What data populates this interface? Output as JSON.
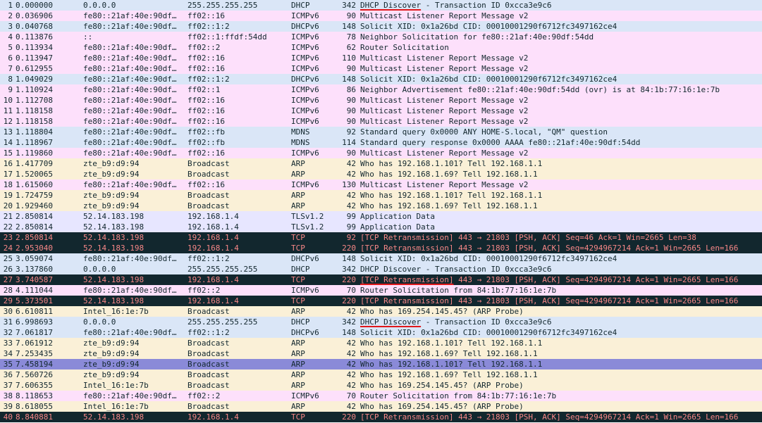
{
  "colors": {
    "dhcp": "#dae6f7",
    "icmpv6": "#fde0fb",
    "arp": "#faf0d7",
    "tls": "#e7e6ff",
    "bad_tcp_bg": "#12272e",
    "bad_tcp_fg": "#f78787",
    "selected": "#8a8ad8",
    "highlight_underline": "#e0181b"
  },
  "packets": [
    {
      "no": "1",
      "time": "0.000000",
      "src": "0.0.0.0",
      "dst": "255.255.255.255",
      "proto": "DHCP",
      "len": "342",
      "info": "DHCP Discover - Transaction ID 0xcca3e9c6",
      "color": "dhcp",
      "hl": "DHCP Discover"
    },
    {
      "no": "2",
      "time": "0.036906",
      "src": "fe80::21af:40e:90df…",
      "dst": "ff02::16",
      "proto": "ICMPv6",
      "len": "90",
      "info": "Multicast Listener Report Message v2",
      "color": "icmp"
    },
    {
      "no": "3",
      "time": "0.040768",
      "src": "fe80::21af:40e:90df…",
      "dst": "ff02::1:2",
      "proto": "DHCPv6",
      "len": "148",
      "info": "Solicit XID: 0x1a26bd CID: 00010001290f6712fc3497162ce4",
      "color": "dhcp"
    },
    {
      "no": "4",
      "time": "0.113876",
      "src": "::",
      "dst": "ff02::1:ffdf:54dd",
      "proto": "ICMPv6",
      "len": "78",
      "info": "Neighbor Solicitation for fe80::21af:40e:90df:54dd",
      "color": "icmp"
    },
    {
      "no": "5",
      "time": "0.113934",
      "src": "fe80::21af:40e:90df…",
      "dst": "ff02::2",
      "proto": "ICMPv6",
      "len": "62",
      "info": "Router Solicitation",
      "color": "icmp"
    },
    {
      "no": "6",
      "time": "0.113947",
      "src": "fe80::21af:40e:90df…",
      "dst": "ff02::16",
      "proto": "ICMPv6",
      "len": "110",
      "info": "Multicast Listener Report Message v2",
      "color": "icmp"
    },
    {
      "no": "7",
      "time": "0.612955",
      "src": "fe80::21af:40e:90df…",
      "dst": "ff02::16",
      "proto": "ICMPv6",
      "len": "90",
      "info": "Multicast Listener Report Message v2",
      "color": "icmp"
    },
    {
      "no": "8",
      "time": "1.049029",
      "src": "fe80::21af:40e:90df…",
      "dst": "ff02::1:2",
      "proto": "DHCPv6",
      "len": "148",
      "info": "Solicit XID: 0x1a26bd CID: 00010001290f6712fc3497162ce4",
      "color": "dhcp"
    },
    {
      "no": "9",
      "time": "1.110924",
      "src": "fe80::21af:40e:90df…",
      "dst": "ff02::1",
      "proto": "ICMPv6",
      "len": "86",
      "info": "Neighbor Advertisement fe80::21af:40e:90df:54dd (ovr) is at 84:1b:77:16:1e:7b",
      "color": "icmp"
    },
    {
      "no": "10",
      "time": "1.112708",
      "src": "fe80::21af:40e:90df…",
      "dst": "ff02::16",
      "proto": "ICMPv6",
      "len": "90",
      "info": "Multicast Listener Report Message v2",
      "color": "icmp"
    },
    {
      "no": "11",
      "time": "1.118158",
      "src": "fe80::21af:40e:90df…",
      "dst": "ff02::16",
      "proto": "ICMPv6",
      "len": "90",
      "info": "Multicast Listener Report Message v2",
      "color": "icmp"
    },
    {
      "no": "12",
      "time": "1.118158",
      "src": "fe80::21af:40e:90df…",
      "dst": "ff02::16",
      "proto": "ICMPv6",
      "len": "90",
      "info": "Multicast Listener Report Message v2",
      "color": "icmp"
    },
    {
      "no": "13",
      "time": "1.118804",
      "src": "fe80::21af:40e:90df…",
      "dst": "ff02::fb",
      "proto": "MDNS",
      "len": "92",
      "info": "Standard query 0x0000 ANY HOME-S.local, \"QM\" question",
      "color": "dhcp"
    },
    {
      "no": "14",
      "time": "1.118967",
      "src": "fe80::21af:40e:90df…",
      "dst": "ff02::fb",
      "proto": "MDNS",
      "len": "114",
      "info": "Standard query response 0x0000 AAAA fe80::21af:40e:90df:54dd",
      "color": "dhcp"
    },
    {
      "no": "15",
      "time": "1.119860",
      "src": "fe80::21af:40e:90df…",
      "dst": "ff02::16",
      "proto": "ICMPv6",
      "len": "90",
      "info": "Multicast Listener Report Message v2",
      "color": "icmp"
    },
    {
      "no": "16",
      "time": "1.417709",
      "src": "zte_b9:d9:94",
      "dst": "Broadcast",
      "proto": "ARP",
      "len": "42",
      "info": "Who has 192.168.1.101? Tell 192.168.1.1",
      "color": "arp"
    },
    {
      "no": "17",
      "time": "1.520065",
      "src": "zte_b9:d9:94",
      "dst": "Broadcast",
      "proto": "ARP",
      "len": "42",
      "info": "Who has 192.168.1.69? Tell 192.168.1.1",
      "color": "arp"
    },
    {
      "no": "18",
      "time": "1.615060",
      "src": "fe80::21af:40e:90df…",
      "dst": "ff02::16",
      "proto": "ICMPv6",
      "len": "130",
      "info": "Multicast Listener Report Message v2",
      "color": "icmp"
    },
    {
      "no": "19",
      "time": "1.724759",
      "src": "zte_b9:d9:94",
      "dst": "Broadcast",
      "proto": "ARP",
      "len": "42",
      "info": "Who has 192.168.1.101? Tell 192.168.1.1",
      "color": "arp"
    },
    {
      "no": "20",
      "time": "1.929460",
      "src": "zte_b9:d9:94",
      "dst": "Broadcast",
      "proto": "ARP",
      "len": "42",
      "info": "Who has 192.168.1.69? Tell 192.168.1.1",
      "color": "arp"
    },
    {
      "no": "21",
      "time": "2.850814",
      "src": "52.14.183.198",
      "dst": "192.168.1.4",
      "proto": "TLSv1.2",
      "len": "99",
      "info": "Application Data",
      "color": "tls"
    },
    {
      "no": "22",
      "time": "2.850814",
      "src": "52.14.183.198",
      "dst": "192.168.1.4",
      "proto": "TLSv1.2",
      "len": "99",
      "info": "Application Data",
      "color": "tls"
    },
    {
      "no": "23",
      "time": "2.850814",
      "src": "52.14.183.198",
      "dst": "192.168.1.4",
      "proto": "TCP",
      "len": "92",
      "info": "[TCP Retransmission] 443 → 21803 [PSH, ACK] Seq=46 Ack=1 Win=2665 Len=38",
      "color": "bad"
    },
    {
      "no": "24",
      "time": "2.953040",
      "src": "52.14.183.198",
      "dst": "192.168.1.4",
      "proto": "TCP",
      "len": "220",
      "info": "[TCP Retransmission] 443 → 21803 [PSH, ACK] Seq=4294967214 Ack=1 Win=2665 Len=166",
      "color": "bad"
    },
    {
      "no": "25",
      "time": "3.059074",
      "src": "fe80::21af:40e:90df…",
      "dst": "ff02::1:2",
      "proto": "DHCPv6",
      "len": "148",
      "info": "Solicit XID: 0x1a26bd CID: 00010001290f6712fc3497162ce4",
      "color": "dhcp"
    },
    {
      "no": "26",
      "time": "3.137860",
      "src": "0.0.0.0",
      "dst": "255.255.255.255",
      "proto": "DHCP",
      "len": "342",
      "info": "DHCP Discover - Transaction ID 0xcca3e9c6",
      "color": "dhcp"
    },
    {
      "no": "27",
      "time": "3.740587",
      "src": "52.14.183.198",
      "dst": "192.168.1.4",
      "proto": "TCP",
      "len": "220",
      "info": "[TCP Retransmission] 443 → 21803 [PSH, ACK] Seq=4294967214 Ack=1 Win=2665 Len=166",
      "color": "bad",
      "hl": "[TCP Retransmission]"
    },
    {
      "no": "28",
      "time": "4.111044",
      "src": "fe80::21af:40e:90df…",
      "dst": "ff02::2",
      "proto": "ICMPv6",
      "len": "70",
      "info": "Router Solicitation from 84:1b:77:16:1e:7b",
      "color": "icmp"
    },
    {
      "no": "29",
      "time": "5.373501",
      "src": "52.14.183.198",
      "dst": "192.168.1.4",
      "proto": "TCP",
      "len": "220",
      "info": "[TCP Retransmission] 443 → 21803 [PSH, ACK] Seq=4294967214 Ack=1 Win=2665 Len=166",
      "color": "bad"
    },
    {
      "no": "30",
      "time": "6.610811",
      "src": "Intel_16:1e:7b",
      "dst": "Broadcast",
      "proto": "ARP",
      "len": "42",
      "info": "Who has 169.254.145.45? (ARP Probe)",
      "color": "arp"
    },
    {
      "no": "31",
      "time": "6.998693",
      "src": "0.0.0.0",
      "dst": "255.255.255.255",
      "proto": "DHCP",
      "len": "342",
      "info": "DHCP Discover - Transaction ID 0xcca3e9c6",
      "color": "dhcp",
      "hl": "DHCP Discover"
    },
    {
      "no": "32",
      "time": "7.061817",
      "src": "fe80::21af:40e:90df…",
      "dst": "ff02::1:2",
      "proto": "DHCPv6",
      "len": "148",
      "info": "Solicit XID: 0x1a26bd CID: 00010001290f6712fc3497162ce4",
      "color": "dhcp"
    },
    {
      "no": "33",
      "time": "7.061912",
      "src": "zte_b9:d9:94",
      "dst": "Broadcast",
      "proto": "ARP",
      "len": "42",
      "info": "Who has 192.168.1.101? Tell 192.168.1.1",
      "color": "arp"
    },
    {
      "no": "34",
      "time": "7.253435",
      "src": "zte_b9:d9:94",
      "dst": "Broadcast",
      "proto": "ARP",
      "len": "42",
      "info": "Who has 192.168.1.69? Tell 192.168.1.1",
      "color": "arp"
    },
    {
      "no": "35",
      "time": "7.458194",
      "src": "zte_b9:d9:94",
      "dst": "Broadcast",
      "proto": "ARP",
      "len": "42",
      "info": "Who has 192.168.1.101? Tell 192.168.1.1",
      "color": "sel"
    },
    {
      "no": "36",
      "time": "7.560726",
      "src": "zte_b9:d9:94",
      "dst": "Broadcast",
      "proto": "ARP",
      "len": "42",
      "info": "Who has 192.168.1.69? Tell 192.168.1.1",
      "color": "arp"
    },
    {
      "no": "37",
      "time": "7.606355",
      "src": "Intel_16:1e:7b",
      "dst": "Broadcast",
      "proto": "ARP",
      "len": "42",
      "info": "Who has 169.254.145.45? (ARP Probe)",
      "color": "arp"
    },
    {
      "no": "38",
      "time": "8.118653",
      "src": "fe80::21af:40e:90df…",
      "dst": "ff02::2",
      "proto": "ICMPv6",
      "len": "70",
      "info": "Router Solicitation from 84:1b:77:16:1e:7b",
      "color": "icmp"
    },
    {
      "no": "39",
      "time": "8.618055",
      "src": "Intel_16:1e:7b",
      "dst": "Broadcast",
      "proto": "ARP",
      "len": "42",
      "info": "Who has 169.254.145.45? (ARP Probe)",
      "color": "arp"
    },
    {
      "no": "40",
      "time": "8.840881",
      "src": "52.14.183.198",
      "dst": "192.168.1.4",
      "proto": "TCP",
      "len": "220",
      "info": "[TCP Retransmission] 443 → 21803 [PSH, ACK] Seq=4294967214 Ack=1 Win=2665 Len=166",
      "color": "bad"
    }
  ]
}
